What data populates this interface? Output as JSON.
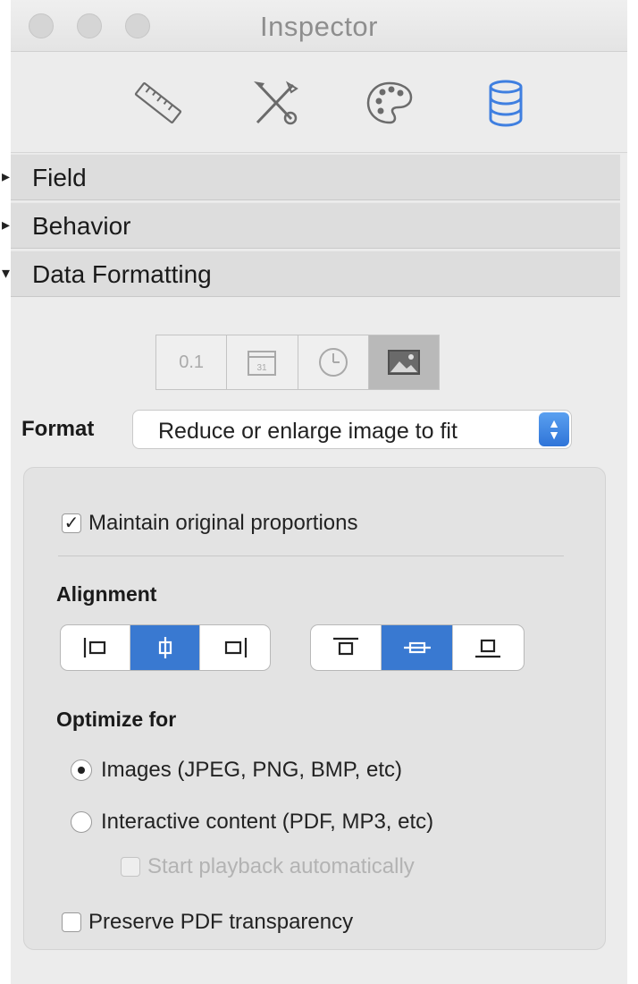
{
  "window": {
    "title": "Inspector"
  },
  "toolbar": {
    "icons": [
      "ruler-icon",
      "tools-icon",
      "palette-icon",
      "database-icon"
    ],
    "active": "database-icon",
    "accent": "#3f7fe0"
  },
  "sections": [
    {
      "label": "Field",
      "expanded": false
    },
    {
      "label": "Behavior",
      "expanded": false
    },
    {
      "label": "Data Formatting",
      "expanded": true
    }
  ],
  "data_types": {
    "number_label": "0.1",
    "date_label": "31",
    "selected": "image"
  },
  "format": {
    "label": "Format",
    "value": "Reduce or enlarge image to fit"
  },
  "maintain": {
    "label": "Maintain original proportions",
    "checked": true
  },
  "alignment": {
    "label": "Alignment",
    "horizontal_selected": "center",
    "vertical_selected": "middle",
    "active_color": "#3979d1"
  },
  "optimize": {
    "label": "Optimize for",
    "options": [
      {
        "label": "Images (JPEG, PNG, BMP, etc)",
        "selected": true
      },
      {
        "label": "Interactive content (PDF, MP3, etc)",
        "selected": false
      }
    ],
    "playback": {
      "label": "Start playback automatically",
      "checked": false,
      "disabled": true
    }
  },
  "preserve": {
    "label": "Preserve PDF transparency",
    "checked": false
  }
}
